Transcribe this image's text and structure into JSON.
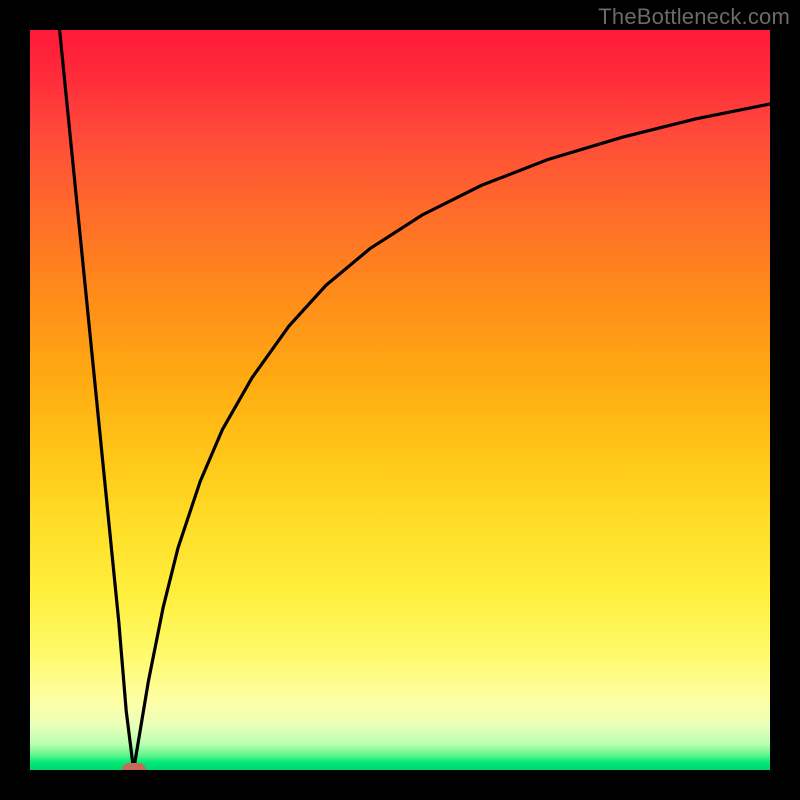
{
  "watermark": "TheBottleneck.com",
  "colors": {
    "frame": "#000000",
    "marker": "#c66a58",
    "curve": "#000000",
    "gradient_stops": [
      "#ff1a3a",
      "#ff2a3a",
      "#ff4a3a",
      "#ff6a2a",
      "#ff8c1a",
      "#ffaa12",
      "#ffc818",
      "#ffe02a",
      "#fff040",
      "#fffb70",
      "#fdffa8",
      "#e8ffb8",
      "#b8ffb0",
      "#60f58a",
      "#00e87a",
      "#00d86a"
    ]
  },
  "chart_data": {
    "type": "line",
    "title": "",
    "xlabel": "",
    "ylabel": "",
    "xlim": [
      0,
      100
    ],
    "ylim": [
      0,
      100
    ],
    "grid": false,
    "vertex_x": 14,
    "series": [
      {
        "name": "left-branch",
        "x": [
          4,
          6,
          8,
          10,
          12,
          13,
          14
        ],
        "values": [
          100,
          80,
          60,
          40,
          20,
          8,
          0
        ]
      },
      {
        "name": "right-branch",
        "x": [
          14,
          15,
          16,
          18,
          20,
          23,
          26,
          30,
          35,
          40,
          46,
          53,
          61,
          70,
          80,
          90,
          100
        ],
        "values": [
          0,
          6,
          12,
          22,
          30,
          39,
          46,
          53,
          60,
          65.5,
          70.5,
          75,
          79,
          82.5,
          85.5,
          88,
          90
        ]
      }
    ],
    "annotations": [
      {
        "kind": "marker",
        "x": 14,
        "y": 0,
        "shape": "rounded-rect",
        "color": "#c66a58"
      }
    ]
  }
}
